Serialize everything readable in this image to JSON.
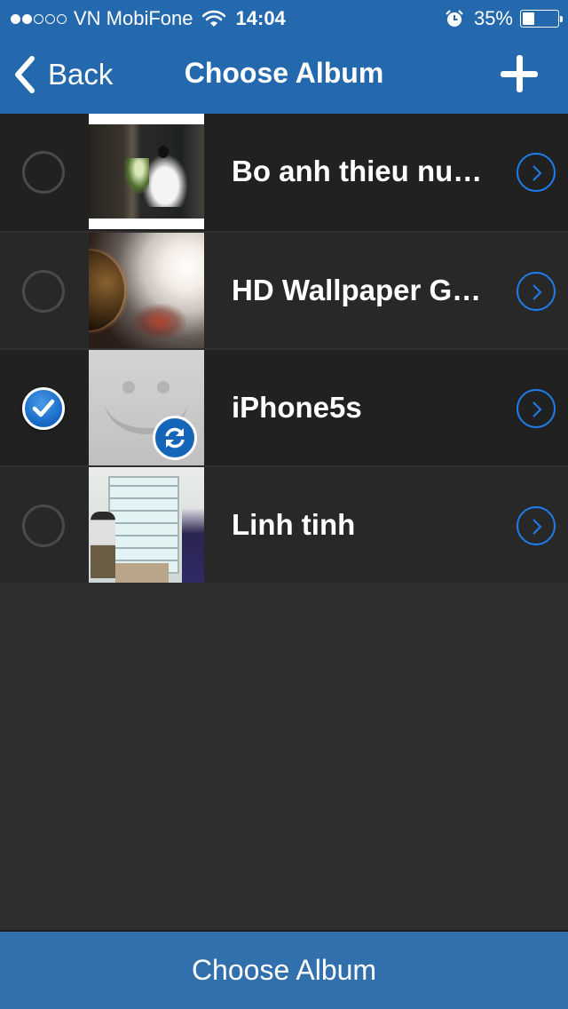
{
  "status_bar": {
    "signal_strength": 2,
    "signal_max": 5,
    "carrier": "VN MobiFone",
    "wifi_icon": "wifi-icon",
    "time": "14:04",
    "alarm_icon": "alarm-clock-icon",
    "battery_percent_label": "35%",
    "battery_level": 0.35
  },
  "nav": {
    "back_label": "Back",
    "title": "Choose Album",
    "add_icon": "plus-icon"
  },
  "albums": [
    {
      "name": "Bo anh thieu nu…",
      "selected": false,
      "thumbnail": "woman in white ao dai with flowers",
      "detail_icon": "chevron-right-circle-icon"
    },
    {
      "name": "HD Wallpaper G…",
      "selected": false,
      "thumbnail": "planet and nebula space wallpaper",
      "detail_icon": "chevron-right-circle-icon"
    },
    {
      "name": "iPhone5s",
      "selected": true,
      "thumbnail": "placeholder smiley with sync badge",
      "badge_icon": "sync-icon",
      "detail_icon": "chevron-right-circle-icon"
    },
    {
      "name": "Linh tinh",
      "selected": false,
      "thumbnail": "man in front of glass display cabinet",
      "detail_icon": "chevron-right-circle-icon"
    }
  ],
  "bottom_button": {
    "label": "Choose Album"
  },
  "colors": {
    "header_blue": "#2468ae",
    "bottom_blue": "#326fad",
    "accent_blue": "#1d7ef0",
    "row_dark": "#212121",
    "row_alt": "#282828",
    "background": "#2f2f2f"
  }
}
